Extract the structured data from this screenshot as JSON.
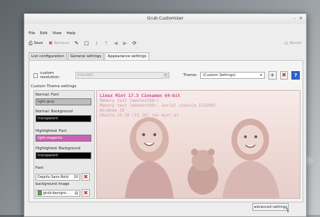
{
  "window": {
    "title": "Grub Customizer",
    "controls": [
      "–",
      "✕"
    ]
  },
  "menubar": {
    "items": [
      "File",
      "Edit",
      "View",
      "Help"
    ]
  },
  "toolbar": {
    "save": "Save",
    "remove": "Remove",
    "revert": "Revert"
  },
  "tabs": [
    {
      "label": "List configuration",
      "active": false
    },
    {
      "label": "General settings",
      "active": false
    },
    {
      "label": "Appearance settings",
      "active": true
    }
  ],
  "appearance": {
    "custom_resolution_label": "custom resolution:",
    "custom_resolution_value": "640x480",
    "custom_resolution_checked": false,
    "theme_label": "Theme:",
    "theme_value": "(Custom Settings)"
  },
  "custom_theme": {
    "section_label": "Custom Theme settings",
    "normal_font_label": "Normal: Font",
    "normal_font_value": "light-gray",
    "normal_background_label": "Normal: Background",
    "normal_background_value": "transparent",
    "highlight_font_label": "Highlighted: Font",
    "highlight_font_value": "light-magenta",
    "highlight_background_label": "Highlighted: Background",
    "highlight_background_value": "transparent",
    "font_label": "Font",
    "font_value": "DejaVu Sans Bold",
    "font_size": "10",
    "background_image_label": "background image",
    "background_image_value": "grub-bacrgro..."
  },
  "preview": {
    "title": "Linux Mint 17.3 Cinnamon 64-bit",
    "lines": [
      "Memory test (memtest86+)",
      "Memory test (memtest86+, serial console 115200)",
      "Windows 10",
      "Ubuntu 15.10 (15.10) (en myvr.e)"
    ]
  },
  "footer": {
    "advanced_settings": "advanced settings"
  },
  "colors": {
    "normal_font": "#bdbdbd",
    "normal_background": "#050505",
    "highlight_font": "#c964b4",
    "highlight_background": "#050505",
    "preview_title": "#d3459f",
    "preview_entry": "#c79aa8",
    "remove_red": "#d23b2f",
    "info_blue": "#2d64c8"
  }
}
